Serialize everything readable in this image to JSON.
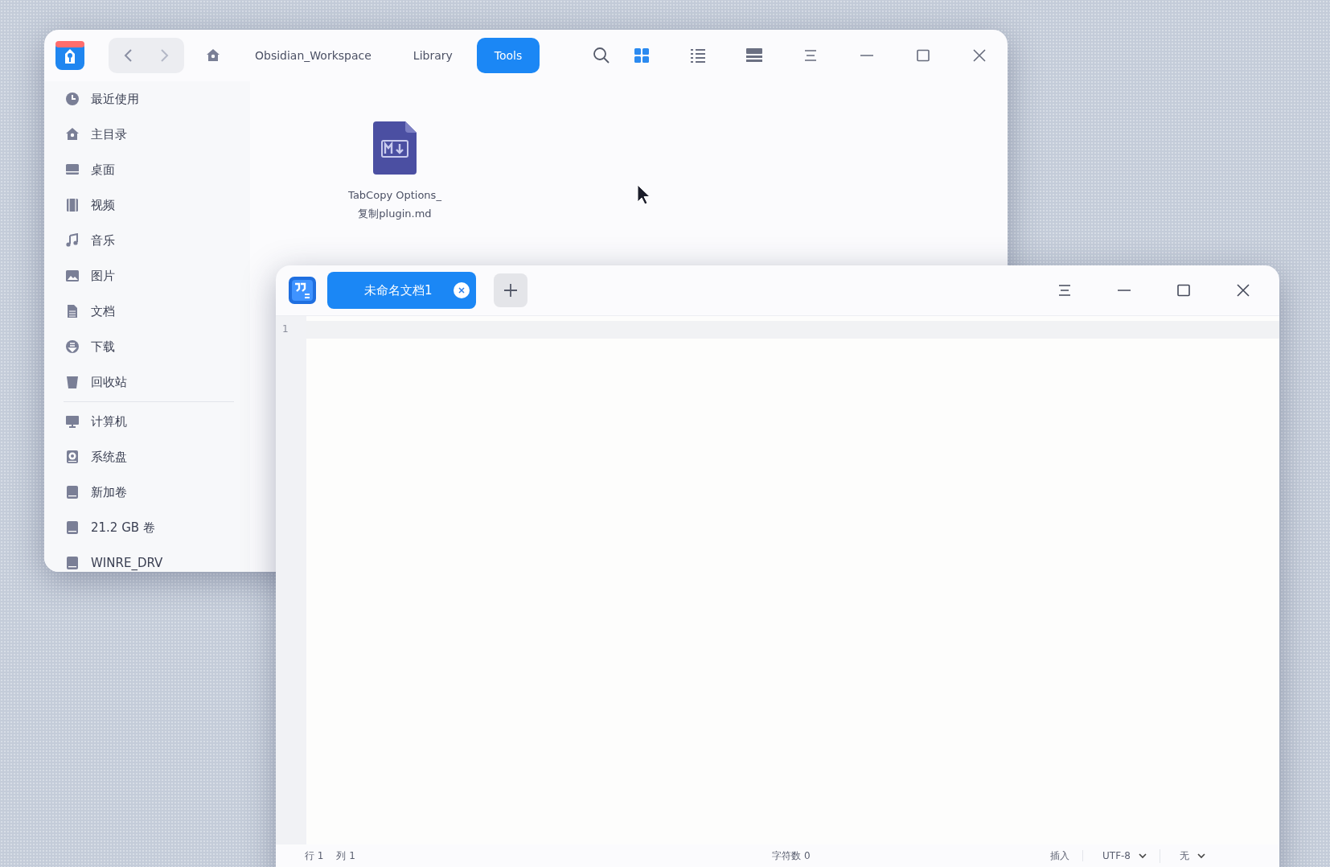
{
  "file_manager": {
    "breadcrumbs": [
      {
        "label": "Obsidian_Workspace",
        "selected": false
      },
      {
        "label": "Library",
        "selected": false
      },
      {
        "label": "Tools",
        "selected": true
      }
    ],
    "view_modes": [
      {
        "kind": "icons",
        "selected": true
      },
      {
        "kind": "list",
        "selected": false
      },
      {
        "kind": "rows",
        "selected": false
      }
    ],
    "sidebar": {
      "places": [
        {
          "kind": "clock",
          "label": "最近使用"
        },
        {
          "kind": "home",
          "label": "主目录"
        },
        {
          "kind": "desktop",
          "label": "桌面"
        },
        {
          "kind": "video",
          "label": "视频"
        },
        {
          "kind": "music",
          "label": "音乐"
        },
        {
          "kind": "picture",
          "label": "图片"
        },
        {
          "kind": "document",
          "label": "文档"
        },
        {
          "kind": "download",
          "label": "下载"
        },
        {
          "kind": "trash",
          "label": "回收站"
        }
      ],
      "devices": [
        {
          "kind": "computer",
          "label": "计算机"
        },
        {
          "kind": "system-disk",
          "label": "系统盘"
        },
        {
          "kind": "disk",
          "label": "新加卷"
        },
        {
          "kind": "disk",
          "label": "21.2 GB 卷"
        },
        {
          "kind": "disk",
          "label": "WINRE_DRV"
        }
      ]
    },
    "files": [
      {
        "kind": "markdown",
        "name": "TabCopy Options_复制plugin.md"
      }
    ]
  },
  "editor": {
    "tabs": [
      {
        "label": "未命名文档1",
        "selected": true
      }
    ],
    "line_numbers": [
      "1"
    ],
    "status_bar": {
      "line": "行 1",
      "column": "列 1",
      "char_count": "字符数 0",
      "mode": "插入",
      "encoding": "UTF-8",
      "line_ending": "无"
    }
  }
}
